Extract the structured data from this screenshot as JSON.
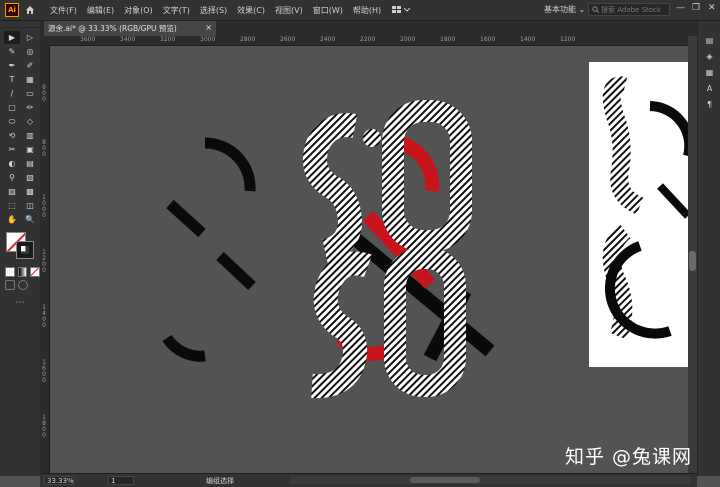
{
  "app": {
    "logo_text": "Ai"
  },
  "menu": [
    "文件(F)",
    "编辑(E)",
    "对象(O)",
    "文字(T)",
    "选择(S)",
    "效果(C)",
    "视图(V)",
    "窗口(W)",
    "帮助(H)"
  ],
  "workspace": {
    "label": "基本功能",
    "chevron": "⌄"
  },
  "search": {
    "placeholder": "搜索 Adobe Stock",
    "icon": "search-icon"
  },
  "window_controls": {
    "minimize": "—",
    "maximize": "❐",
    "close": "✕"
  },
  "document": {
    "tab_title": "源余.ai* @ 33.33% (RGB/GPU 预览)",
    "close": "×"
  },
  "ruler": {
    "h_ticks": [
      "3600",
      "3400",
      "3200",
      "3000",
      "2800",
      "2600",
      "2400",
      "2200",
      "2000",
      "1800",
      "1600",
      "1400",
      "1200"
    ],
    "v_ticks": [
      "600",
      "800",
      "1000",
      "1200",
      "1400",
      "1600",
      "1800"
    ]
  },
  "tools": [
    "▶",
    "▷",
    "✎",
    "◎",
    "✒",
    "✐",
    "T",
    "▦",
    "/",
    "▭",
    "▢",
    "✏",
    "⬭",
    "◇",
    "⟲",
    "▥",
    "✂",
    "▣",
    "◐",
    "▤",
    "⚲",
    "▧",
    "▨",
    "▩",
    "⬚",
    "◫",
    "✋",
    "🔍"
  ],
  "status": {
    "zoom": "33.33%",
    "page": "1",
    "tool_name": "编组选择"
  },
  "watermark": {
    "text": "知乎 @兔课网"
  },
  "colors": {
    "accent_red": "#c8141a",
    "art_black": "#0a0a0a",
    "canvas_bg": "#535353",
    "panel_bg": "#323232"
  }
}
